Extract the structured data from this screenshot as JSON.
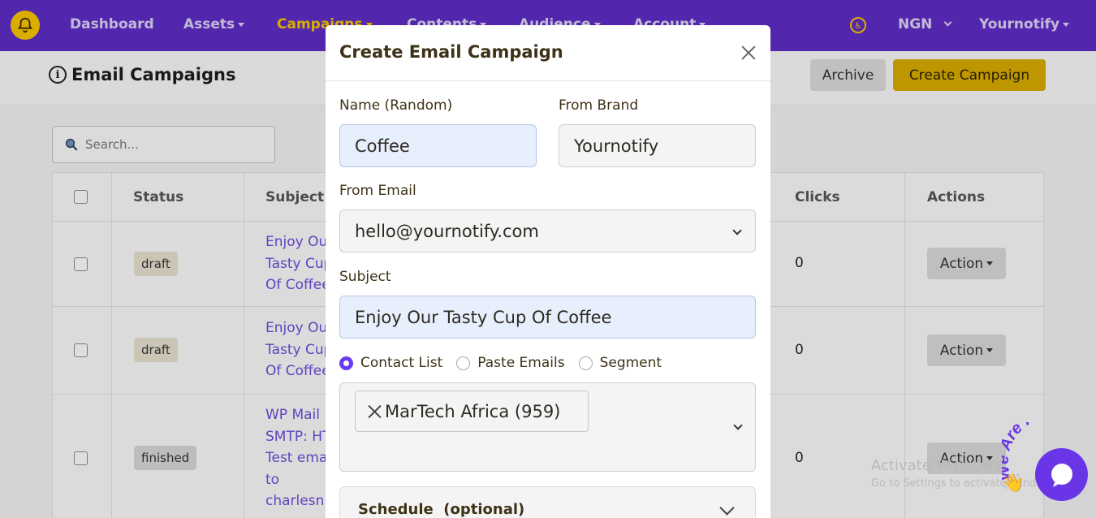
{
  "navbar": {
    "items": [
      {
        "label": "Dashboard",
        "caret": false
      },
      {
        "label": "Assets",
        "caret": true
      },
      {
        "label": "Campaigns",
        "caret": true,
        "active": true
      },
      {
        "label": "Contents",
        "caret": true
      },
      {
        "label": "Audience",
        "caret": true
      },
      {
        "label": "Account",
        "caret": true
      }
    ],
    "currency": "NGN",
    "brand_menu": "Yournotify",
    "colors": {
      "bg": "#5d2bc2",
      "accent": "#f2c200"
    }
  },
  "page": {
    "title": "Email Campaigns",
    "archive_label": "Archive",
    "create_label": "Create Campaign",
    "search_placeholder": "Search...",
    "columns": {
      "status": "Status",
      "subject": "Subject",
      "clicks": "Clicks",
      "actions": "Actions"
    },
    "rows": [
      {
        "status": "draft",
        "subject": [
          "Enjoy Our",
          "Tasty Cup",
          "Of Coffee"
        ],
        "clicks": "0",
        "action": "Action"
      },
      {
        "status": "draft",
        "subject": [
          "Enjoy Our",
          "Tasty Cup",
          "Of Coffee"
        ],
        "clicks": "0",
        "action": "Action"
      },
      {
        "status": "finished",
        "subject": [
          "WP Mail",
          "SMTP: HT",
          "Test ema",
          "to",
          "charlesn"
        ],
        "clicks": "0",
        "action": "Action"
      }
    ]
  },
  "modal": {
    "title": "Create Email Campaign",
    "name_label": "Name (Random)",
    "name_value": "Coffee",
    "brand_label": "From Brand",
    "brand_value": "Yournotify",
    "email_label": "From Email",
    "email_value": "hello@yournotify.com",
    "subject_label": "Subject",
    "subject_value": "Enjoy Our Tasty Cup Of Coffee",
    "recipient_options": [
      {
        "label": "Contact List",
        "selected": true
      },
      {
        "label": "Paste Emails",
        "selected": false
      },
      {
        "label": "Segment",
        "selected": false
      }
    ],
    "selected_list": "MarTech Africa (959)",
    "schedule_label": "Schedule  (optional)"
  },
  "watermark": {
    "line1": "Activate Windows",
    "line2": "Go to Settings to activate Windows."
  },
  "chat": {
    "banner": "We Are Here!"
  }
}
